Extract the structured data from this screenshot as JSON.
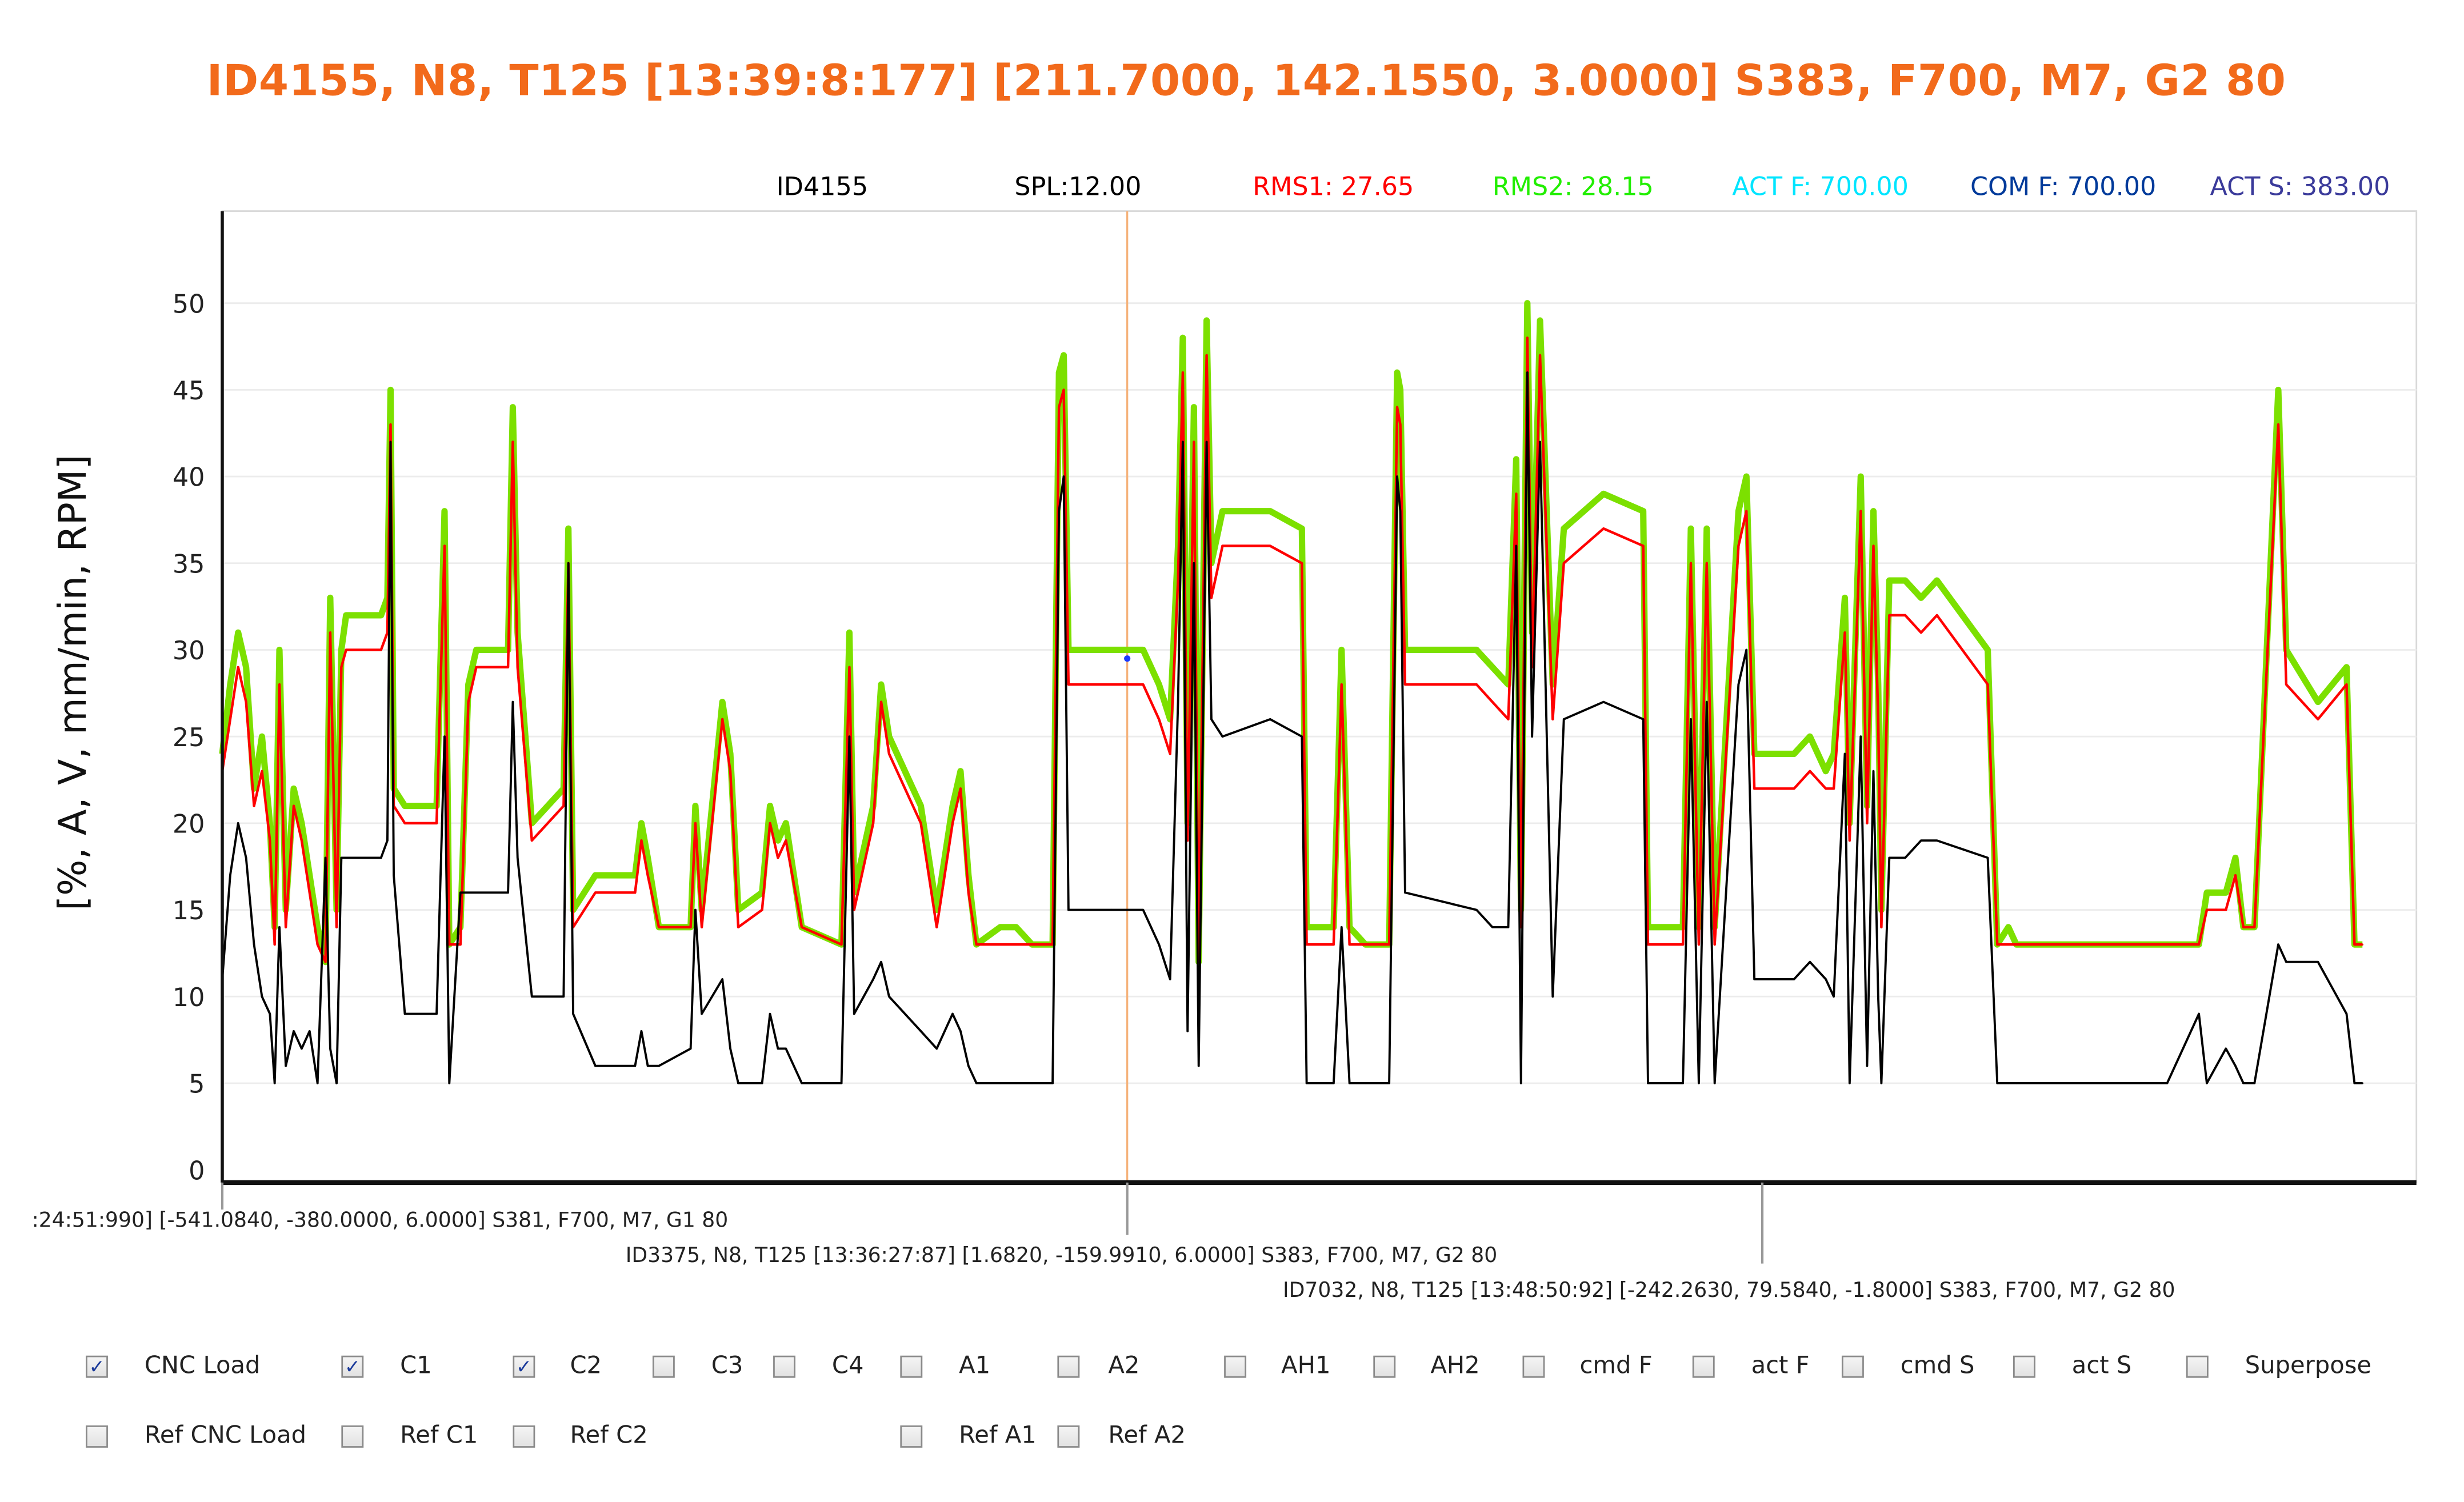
{
  "title": "ID4155, N8, T125 [13:39:8:177] [211.7000, 142.1550, 3.0000] S383, F700, M7, G2 80",
  "stats": [
    {
      "label": "ID4155",
      "color": "#000000"
    },
    {
      "label": "SPL:12.00",
      "color": "#000000"
    },
    {
      "label": "RMS1: 27.65",
      "color": "#ff0000"
    },
    {
      "label": "RMS2: 28.15",
      "color": "#22ee00"
    },
    {
      "label": "ACT F: 700.00",
      "color": "#00e5ff"
    },
    {
      "label": "COM F: 700.00",
      "color": "#003a9a"
    },
    {
      "label": "ACT S: 383.00",
      "color": "#3a3a9a"
    }
  ],
  "markers": [
    {
      "text": ":24:51:990] [-541.0840, -380.0000, 6.0000] S381, F700, M7, G1 80"
    },
    {
      "text": "ID3375, N8, T125 [13:36:27:87] [1.6820, -159.9910, 6.0000] S383, F700, M7, G2 80"
    },
    {
      "text": "ID7032, N8, T125 [13:48:50:92] [-242.2630, 79.5840, -1.8000] S383, F700, M7, G2 80"
    }
  ],
  "checkboxes_row1": [
    {
      "label": "CNC Load",
      "checked": true
    },
    {
      "label": "C1",
      "checked": true
    },
    {
      "label": "C2",
      "checked": true
    },
    {
      "label": "C3",
      "checked": false
    },
    {
      "label": "C4",
      "checked": false
    },
    {
      "label": "A1",
      "checked": false
    },
    {
      "label": "A2",
      "checked": false
    },
    {
      "label": "AH1",
      "checked": false
    },
    {
      "label": "AH2",
      "checked": false
    },
    {
      "label": "cmd F",
      "checked": false
    },
    {
      "label": "act F",
      "checked": false
    },
    {
      "label": "cmd S",
      "checked": false
    },
    {
      "label": "act S",
      "checked": false
    },
    {
      "label": "Superpose",
      "checked": false
    }
  ],
  "checkboxes_row2": [
    {
      "label": "Ref CNC Load",
      "checked": false
    },
    {
      "label": "Ref C1",
      "checked": false
    },
    {
      "label": "Ref C2",
      "checked": false
    },
    {
      "label": "Ref A1",
      "checked": false
    },
    {
      "label": "Ref A2",
      "checked": false
    }
  ],
  "chart_data": {
    "type": "line",
    "title": "ID4155, N8, T125 [13:39:8:177] [211.7000, 142.1550, 3.0000] S383, F700, M7, G2 80",
    "xlabel": "",
    "ylabel": "[%, A, V, mm/min, RPM]",
    "ylim": [
      0,
      55
    ],
    "yticks": [
      "0",
      "5",
      "10",
      "15",
      "20",
      "25",
      "30",
      "35",
      "40",
      "45",
      "50"
    ],
    "grid": true,
    "x": [
      0,
      5,
      10,
      15,
      20,
      25,
      30,
      33,
      36,
      40,
      45,
      50,
      55,
      60,
      65,
      68,
      72,
      75,
      78,
      100,
      104,
      106,
      108,
      115,
      135,
      140,
      143,
      150,
      155,
      160,
      180,
      183,
      186,
      195,
      215,
      218,
      221,
      235,
      260,
      264,
      268,
      275,
      295,
      298,
      302,
      315,
      320,
      325,
      340,
      345,
      350,
      355,
      365,
      390,
      395,
      398,
      410,
      415,
      420,
      440,
      450,
      460,
      465,
      470,
      475,
      490,
      500,
      510,
      523,
      527,
      530,
      533,
      560,
      580,
      590,
      597,
      602,
      605,
      608,
      612,
      615,
      620,
      623,
      630,
      660,
      680,
      683,
      700,
      705,
      710,
      720,
      735,
      740,
      742,
      745,
      790,
      800,
      810,
      815,
      818,
      822,
      825,
      830,
      838,
      845,
      870,
      895,
      898,
      920,
      925,
      930,
      935,
      940,
      955,
      960,
      965,
      990,
      1000,
      1010,
      1015,
      1022,
      1025,
      1032,
      1036,
      1040,
      1043,
      1045,
      1050,
      1060,
      1070,
      1080,
      1112,
      1118,
      1125,
      1130,
      1225,
      1245,
      1250,
      1262,
      1268,
      1273,
      1280,
      1295,
      1300,
      1320,
      1338,
      1343,
      1348
    ],
    "xlim": [
      0,
      1380
    ],
    "cursor_x": 570,
    "series": [
      {
        "name": "C2",
        "color": "#7ce000",
        "values": [
          24,
          28,
          31,
          29,
          22,
          25,
          20,
          14,
          30,
          15,
          22,
          20,
          17,
          14,
          12,
          33,
          15,
          30,
          32,
          32,
          33,
          45,
          22,
          21,
          21,
          38,
          13,
          14,
          28,
          30,
          30,
          44,
          31,
          20,
          22,
          37,
          15,
          17,
          17,
          20,
          18,
          14,
          14,
          21,
          15,
          27,
          24,
          15,
          16,
          21,
          19,
          20,
          14,
          13,
          31,
          16,
          21,
          28,
          25,
          21,
          15,
          21,
          23,
          17,
          13,
          14,
          14,
          13,
          13,
          46,
          47,
          30,
          30,
          30,
          28,
          26,
          36,
          48,
          20,
          44,
          12,
          49,
          35,
          38,
          38,
          37,
          14,
          14,
          30,
          14,
          13,
          13,
          46,
          45,
          30,
          30,
          29,
          28,
          41,
          15,
          50,
          31,
          49,
          28,
          37,
          39,
          38,
          14,
          14,
          37,
          14,
          37,
          14,
          38,
          40,
          24,
          24,
          25,
          23,
          24,
          33,
          20,
          40,
          21,
          38,
          28,
          15,
          34,
          34,
          33,
          34,
          30,
          13,
          14,
          13,
          13,
          13,
          16,
          16,
          18,
          14,
          14,
          45,
          30,
          27,
          29,
          13,
          13
        ]
      },
      {
        "name": "C1",
        "color": "#ff0000",
        "values": [
          23,
          26,
          29,
          27,
          21,
          23,
          19,
          13,
          28,
          14,
          21,
          19,
          16,
          13,
          12,
          31,
          14,
          29,
          30,
          30,
          31,
          43,
          21,
          20,
          20,
          36,
          13,
          13,
          27,
          29,
          29,
          42,
          29,
          19,
          21,
          35,
          14,
          16,
          16,
          19,
          17,
          14,
          14,
          20,
          14,
          26,
          23,
          14,
          15,
          20,
          18,
          19,
          14,
          13,
          29,
          15,
          20,
          27,
          24,
          20,
          14,
          20,
          22,
          16,
          13,
          13,
          13,
          13,
          13,
          44,
          45,
          28,
          28,
          28,
          26,
          24,
          34,
          46,
          19,
          42,
          12,
          47,
          33,
          36,
          36,
          35,
          13,
          13,
          28,
          13,
          13,
          13,
          44,
          43,
          28,
          28,
          27,
          26,
          39,
          14,
          48,
          29,
          47,
          26,
          35,
          37,
          36,
          13,
          13,
          35,
          13,
          35,
          13,
          36,
          38,
          22,
          22,
          23,
          22,
          22,
          31,
          19,
          38,
          20,
          36,
          26,
          14,
          32,
          32,
          31,
          32,
          28,
          13,
          13,
          13,
          13,
          13,
          15,
          15,
          17,
          14,
          14,
          43,
          28,
          26,
          28,
          13,
          13
        ]
      },
      {
        "name": "CNC Load",
        "color": "#000000",
        "values": [
          11,
          17,
          20,
          18,
          13,
          10,
          9,
          5,
          14,
          6,
          8,
          7,
          8,
          5,
          18,
          7,
          5,
          18,
          18,
          18,
          19,
          42,
          17,
          9,
          9,
          25,
          5,
          16,
          16,
          16,
          16,
          27,
          18,
          10,
          10,
          35,
          9,
          6,
          6,
          8,
          6,
          6,
          7,
          15,
          9,
          11,
          7,
          5,
          5,
          9,
          7,
          7,
          5,
          5,
          25,
          9,
          11,
          12,
          10,
          8,
          7,
          9,
          8,
          6,
          5,
          5,
          5,
          5,
          5,
          38,
          40,
          15,
          15,
          15,
          13,
          11,
          27,
          42,
          8,
          35,
          6,
          42,
          26,
          25,
          26,
          25,
          5,
          5,
          14,
          5,
          5,
          5,
          40,
          38,
          16,
          15,
          14,
          14,
          36,
          5,
          46,
          25,
          42,
          10,
          26,
          27,
          26,
          5,
          5,
          26,
          5,
          27,
          5,
          28,
          30,
          11,
          11,
          12,
          11,
          10,
          24,
          5,
          25,
          6,
          23,
          10,
          5,
          18,
          18,
          19,
          19,
          18,
          5,
          5,
          5,
          5,
          9,
          5,
          7,
          6,
          5,
          5,
          13,
          12,
          12,
          9,
          5,
          5
        ]
      }
    ]
  }
}
